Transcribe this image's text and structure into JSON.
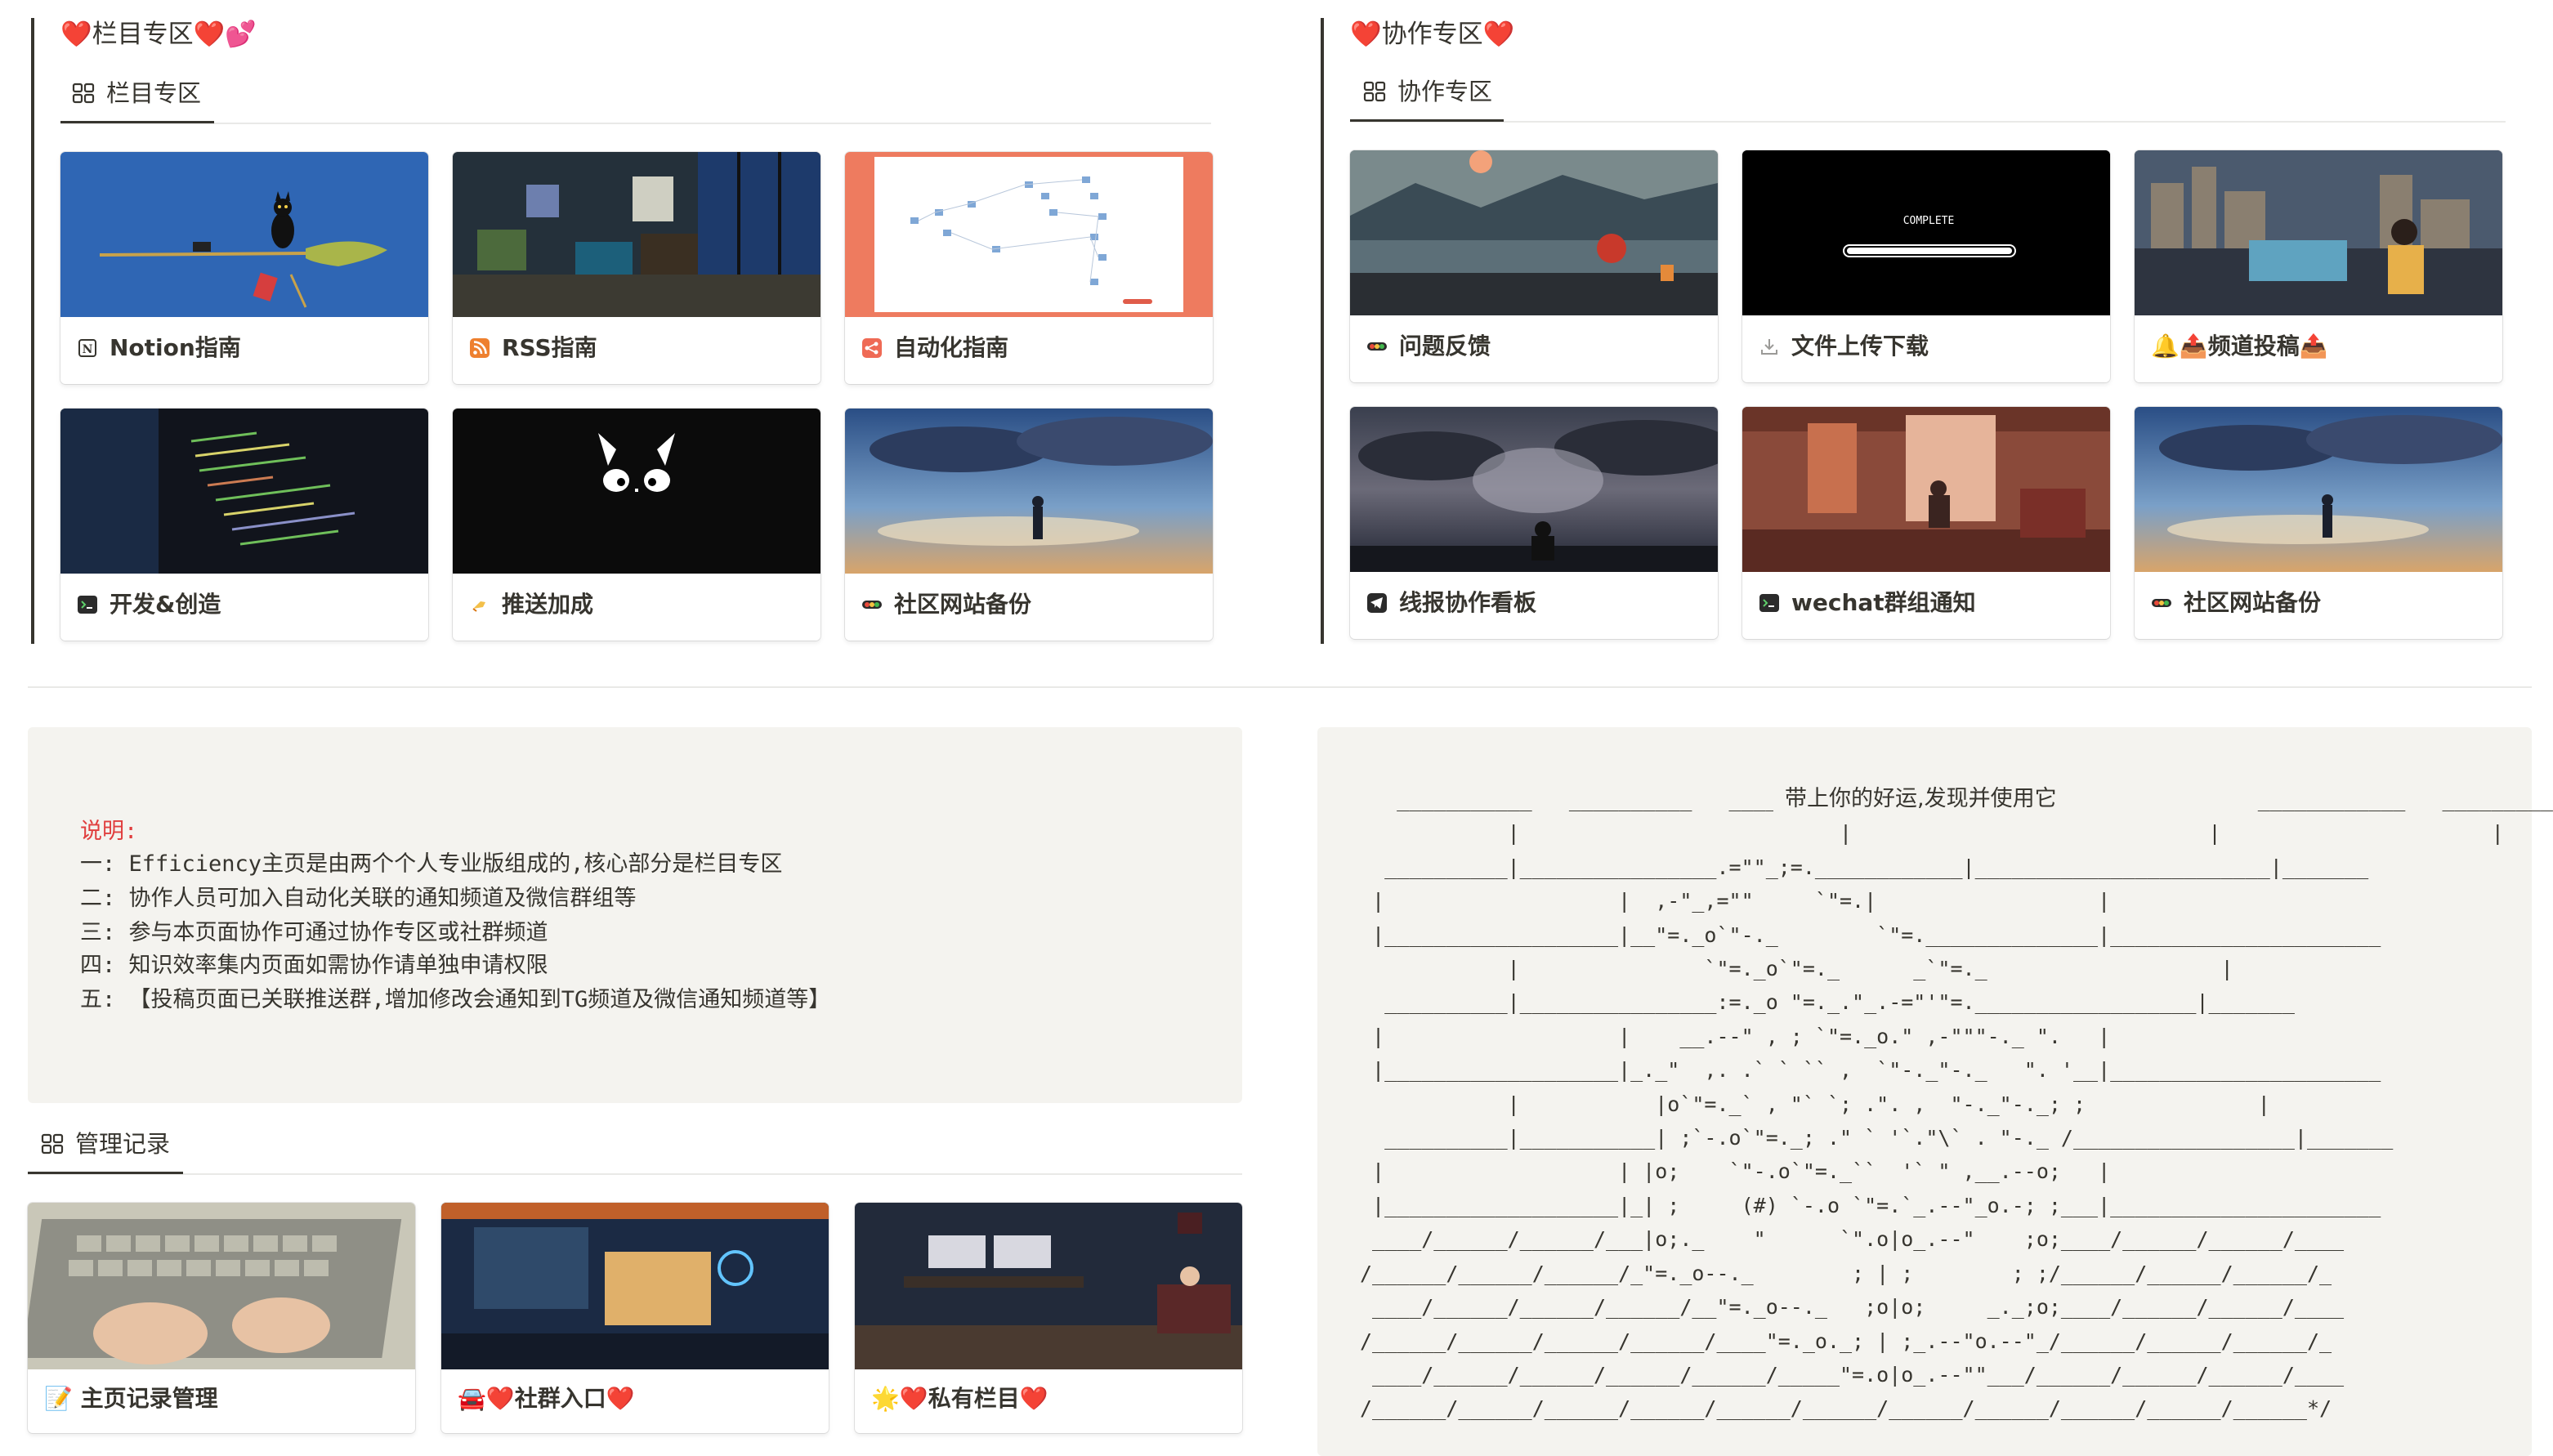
{
  "left_section": {
    "title": "❤️栏目专区❤️💕",
    "tab_label": "栏目专区",
    "cards": [
      {
        "label": "Notion指南",
        "icon": "notion-icon"
      },
      {
        "label": "RSS指南",
        "icon": "rss-icon"
      },
      {
        "label": "自动化指南",
        "icon": "automation-icon"
      },
      {
        "label": "开发&创造",
        "icon": "terminal-icon"
      },
      {
        "label": "推送加成",
        "icon": "push-icon"
      },
      {
        "label": "社区网站备份",
        "icon": "traffic-light-icon"
      }
    ]
  },
  "right_section": {
    "title": "❤️协作专区❤️",
    "tab_label": "协作专区",
    "cards": [
      {
        "label": "问题反馈",
        "icon": "traffic-light-icon"
      },
      {
        "label": "文件上传下载",
        "icon": "download-icon"
      },
      {
        "label": "🔔📤频道投稿📤",
        "icon": "bell-icon"
      },
      {
        "label": "线报协作看板",
        "icon": "telegram-icon"
      },
      {
        "label": "wechat群组通知",
        "icon": "terminal-icon"
      },
      {
        "label": "社区网站备份",
        "icon": "traffic-light-icon"
      }
    ],
    "complete_text": "COMPLETE"
  },
  "description": {
    "heading": "说明:",
    "lines": [
      "一: Efficiency主页是由两个个人专业版组成的,核心部分是栏目专区",
      "二: 协作人员可加入自动化关联的通知频道及微信群组等",
      "三: 参与本页面协作可通过协作专区或社群频道",
      "四: 知识效率集内页面如需协作请单独申请权限",
      "五: 【投稿页面已关联推送群,增加修改会通知到TG频道及微信通知频道等】"
    ]
  },
  "management": {
    "tab_label": "管理记录",
    "cards": [
      {
        "label": "📝 主页记录管理",
        "icon": "memo-icon"
      },
      {
        "label": "🚘❤️社群入口❤️",
        "icon": "car-icon"
      },
      {
        "label": "🌟❤️私有栏目❤️",
        "icon": "star-icon"
      }
    ]
  },
  "ascii_art": {
    "caption": "带上你的好运,发现并使用它",
    "text": "   ___________   __________   _______                                    ____________   __________\n            |                          |                             |                      |\n  __________|________________.=\"\"_;=.____________|________________________|_______\n |                   |  ,-\"_,=\"\"     `\"=.|                  |\n |___________________|__\"=._o`\"-._        `\"=.______________|______________________\n            |               `\"=._o`\"=._      _`\"=._                   |\n  __________|________________:=._o \"=._.\"_.-=\"'\"=.__________________|_______\n |                   |    __.--\" , ; `\"=._o.\" ,-\"\"\"-._ \".   |\n |___________________|_._\"  ,. .` ` `` ,  `\"-._\"-._   \". '__|______________________\n            |           |o`\"=._` , \"` `; .\". ,  \"-._\"-._; ;              |\n  __________|___________| ;`-.o`\"=._; .\" ` '`.\"\\` . \"-._ /__________________|_______\n |                   | |o;    `\"-.o`\"=._``  '` \" ,__.--o;   |\n |___________________|_| ;     (#) `-.o `\"=.`_.--\"_o.-; ;___|______________________\n ____/______/______/___|o;._    \"      `\".o|o_.--\"    ;o;____/______/______/____\n/______/______/______/_\"=._o--._        ; | ;        ; ;/______/______/______/_\n ____/______/______/______/__\"=._o--._   ;o|o;     _._;o;____/______/______/____\n/______/______/______/______/____\"=._o._; | ;_.--\"o.--\"_/______/______/______/_\n ____/______/______/______/______/_____\"=.o|o_.--\"\"___/______/______/______/____\n/______/______/______/______/______/______/______/______/______/______/______*/"
  },
  "colors": {
    "text": "#37352f",
    "callout_bg": "#f4f3ef",
    "description_heading": "#e03e3e",
    "accent_orange": "#d9730d"
  }
}
